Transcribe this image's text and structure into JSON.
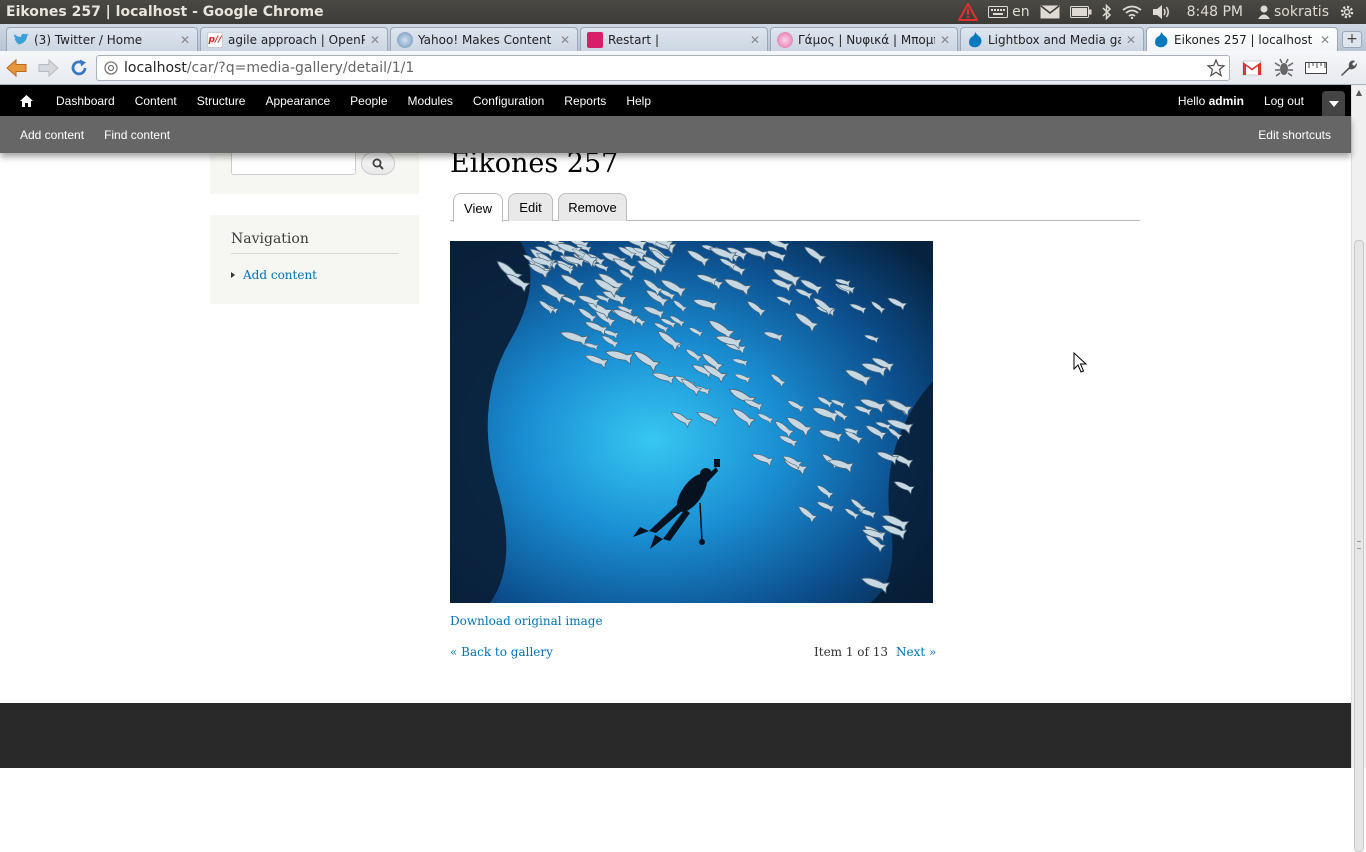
{
  "os_panel": {
    "window_title": "Eikones 257 | localhost - Google Chrome",
    "keyboard_layout": "en",
    "clock": "8:48 PM",
    "user": "sokratis"
  },
  "browser": {
    "tabs": [
      {
        "title": "(3) Twitter / Home",
        "icon": "twitter-icon",
        "active": false
      },
      {
        "title": "agile approach | OpenPub",
        "icon": "openpublish-icon",
        "active": false
      },
      {
        "title": "Yahoo! Makes Content An",
        "icon": "yahoo-icon",
        "active": false
      },
      {
        "title": "Restart |",
        "icon": "restart-icon",
        "active": false
      },
      {
        "title": "Γάμος | Νυφικά | Μπομπον",
        "icon": "flower-icon",
        "active": false
      },
      {
        "title": "Lightbox and Media galle",
        "icon": "drupal-icon",
        "active": false
      },
      {
        "title": "Eikones 257 | localhost",
        "icon": "drupal-icon",
        "active": true
      }
    ],
    "new_tab_label": "+",
    "url_host": "localhost",
    "url_path": "/car/?q=media-gallery/detail/1/1"
  },
  "drupal_toolbar": {
    "menu": [
      "Dashboard",
      "Content",
      "Structure",
      "Appearance",
      "People",
      "Modules",
      "Configuration",
      "Reports",
      "Help"
    ],
    "hello_prefix": "Hello ",
    "username": "admin",
    "logout": "Log out",
    "shortcuts": [
      "Add content",
      "Find content"
    ],
    "edit_shortcuts": "Edit shortcuts"
  },
  "sidebar": {
    "navigation_title": "Navigation",
    "navigation_links": [
      "Add content"
    ]
  },
  "content": {
    "title": "Eikones 257",
    "tabs": [
      "View",
      "Edit",
      "Remove"
    ],
    "active_tab": "View",
    "download_link": "Download original image",
    "back_link": "« Back to gallery",
    "pager_count": "Item 1 of 13",
    "next_link": "Next »"
  }
}
